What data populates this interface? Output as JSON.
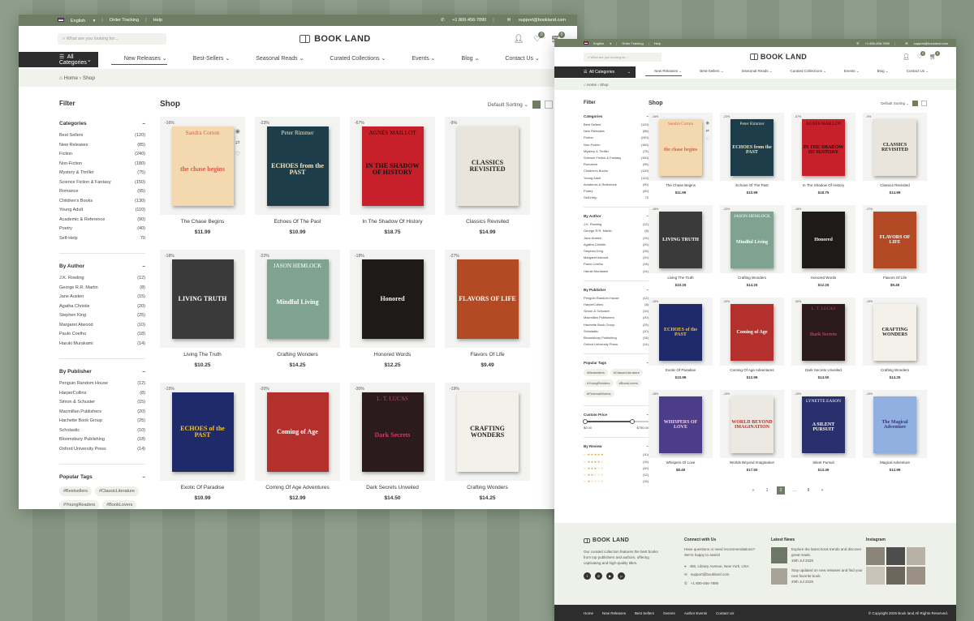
{
  "topbar": {
    "language": "English",
    "order_tracking": "Order Tracking",
    "help": "Help",
    "phone": "+1 800-456-7890",
    "email": "support@bookland.com"
  },
  "header": {
    "search_placeholder": "What are you looking for...",
    "logo": "BOOK LAND",
    "wishlist_count": "0",
    "cart_count": "0"
  },
  "nav": {
    "all_categories": "All Categories",
    "items": [
      "New Releases",
      "Best-Sellers",
      "Seasonal Reads",
      "Curated Collections",
      "Events",
      "Blog",
      "Contact Us"
    ]
  },
  "breadcrumb": {
    "home": "Home",
    "current": "Shop"
  },
  "filter": {
    "title": "Filter",
    "categories": {
      "heading": "Categories",
      "items": [
        {
          "label": "Best Sellers",
          "count": "(120)"
        },
        {
          "label": "New Releases",
          "count": "(85)"
        },
        {
          "label": "Fiction",
          "count": "(240)"
        },
        {
          "label": "Non-Fiction",
          "count": "(180)"
        },
        {
          "label": "Mystery & Thriller",
          "count": "(75)"
        },
        {
          "label": "Science Fiction & Fantasy",
          "count": "(150)"
        },
        {
          "label": "Romance",
          "count": "(95)"
        },
        {
          "label": "Children's Books",
          "count": "(130)"
        },
        {
          "label": "Young Adult",
          "count": "(110)"
        },
        {
          "label": "Academic & Reference",
          "count": "(90)"
        },
        {
          "label": "Poetry",
          "count": "(40)"
        },
        {
          "label": "Self-Help",
          "count": "70"
        }
      ]
    },
    "authors": {
      "heading": "By Author",
      "items": [
        {
          "label": "J.K. Rowling",
          "count": "(12)"
        },
        {
          "label": "George R.R. Martin",
          "count": "(8)"
        },
        {
          "label": "Jane Austen",
          "count": "(15)"
        },
        {
          "label": "Agatha Christie",
          "count": "(20)"
        },
        {
          "label": "Stephen King",
          "count": "(25)"
        },
        {
          "label": "Margaret Atwood",
          "count": "(10)"
        },
        {
          "label": "Paulo Coelho",
          "count": "(18)"
        },
        {
          "label": "Haruki Murakami",
          "count": "(14)"
        }
      ]
    },
    "publishers": {
      "heading": "By Publisher",
      "items": [
        {
          "label": "Penguin Random House",
          "count": "(12)"
        },
        {
          "label": "HarperCollins",
          "count": "(8)"
        },
        {
          "label": "Simon & Schuster",
          "count": "(15)"
        },
        {
          "label": "Macmillan Publishers",
          "count": "(20)"
        },
        {
          "label": "Hachette Book Group",
          "count": "(25)"
        },
        {
          "label": "Scholastic",
          "count": "(10)"
        },
        {
          "label": "Bloomsbury Publishing",
          "count": "(18)"
        },
        {
          "label": "Oxford University Press",
          "count": "(14)"
        }
      ]
    },
    "tags": {
      "heading": "Popular Tags",
      "items": [
        "#Bestsellers",
        "#ClassicLiterature",
        "#YoungReaders",
        "#BookLovers",
        "#FictionalWorlds"
      ]
    },
    "price": {
      "heading": "Custom Price",
      "min": "$0.00",
      "max": "$750.00",
      "fill": 0.75
    },
    "review": {
      "heading": "By Review",
      "items": [
        {
          "stars": 5,
          "count": "(10)"
        },
        {
          "stars": 4,
          "count": "(15)"
        },
        {
          "stars": 3,
          "count": "(40)"
        },
        {
          "stars": 2,
          "count": "(12)"
        },
        {
          "stars": 1,
          "count": "(15)"
        }
      ]
    }
  },
  "shop": {
    "title": "Shop",
    "sort": "Default Sorting",
    "pagination": [
      "«",
      "1",
      "2",
      "...",
      "8",
      "»"
    ],
    "current_page": "2"
  },
  "books": [
    {
      "title": "The Chase Begins",
      "price": "$11.99",
      "discount": "-16%",
      "cover_title": "the chase begins",
      "cover_author": "Sandra Corton",
      "bg": "#f4d9b0",
      "fg": "#e05a48"
    },
    {
      "title": "Echoes Of The Past",
      "price": "$10.99",
      "discount": "-23%",
      "cover_title": "ECHOES from the PAST",
      "cover_author": "Peter Rimmer",
      "bg": "#1d3d4a",
      "fg": "#f2e6c8"
    },
    {
      "title": "In The Shadow Of History",
      "price": "$18.75",
      "discount": "-67%",
      "cover_title": "IN THE SHADOW OF HISTORY",
      "cover_author": "AGNÈS MAILLOT",
      "bg": "#c8202a",
      "fg": "#111"
    },
    {
      "title": "Classics Revisited",
      "price": "$14.99",
      "discount": "-9%",
      "cover_title": "CLASSICS REVISITED",
      "cover_author": "",
      "bg": "#e9e5dc",
      "fg": "#222"
    },
    {
      "title": "Living The Truth",
      "price": "$10.25",
      "discount": "-18%",
      "cover_title": "LIVING TRUTH",
      "cover_author": "",
      "bg": "#3a3a3a",
      "fg": "#fff"
    },
    {
      "title": "Crafting Wonders",
      "price": "$14.25",
      "discount": "-22%",
      "cover_title": "Mindful Living",
      "cover_author": "JASON HEMLOCK",
      "bg": "#7fa291",
      "fg": "#fff"
    },
    {
      "title": "Honored Words",
      "price": "$12.25",
      "discount": "-18%",
      "cover_title": "Honored",
      "cover_author": "",
      "bg": "#1e1a17",
      "fg": "#f2f2f2"
    },
    {
      "title": "Flavors Of Life",
      "price": "$9.49",
      "discount": "-27%",
      "cover_title": "FLAVORS OF LIFE",
      "cover_author": "",
      "bg": "#b34a23",
      "fg": "#fff"
    },
    {
      "title": "Exotic Of Paradise",
      "price": "$10.99",
      "discount": "-15%",
      "cover_title": "ECHOES of the PAST",
      "cover_author": "",
      "bg": "#1f2a6b",
      "fg": "#f2c53a"
    },
    {
      "title": "Coming Of Age Adventures",
      "price": "$12.99",
      "discount": "-20%",
      "cover_title": "Coming of Age",
      "cover_author": "",
      "bg": "#b3302c",
      "fg": "#fff"
    },
    {
      "title": "Dark Secrets Unveiled",
      "price": "$14.50",
      "discount": "-30%",
      "cover_title": "Dark Secrets",
      "cover_author": "L. T. LUCAS",
      "bg": "#2b1a1e",
      "fg": "#d43a66"
    },
    {
      "title": "Crafting Wonders",
      "price": "$14.25",
      "discount": "-19%",
      "cover_title": "CRAFTING WONDERS",
      "cover_author": "",
      "bg": "#f4f0ea",
      "fg": "#222"
    },
    {
      "title": "Whispers Of Love",
      "price": "$8.49",
      "discount": "-18%",
      "cover_title": "WHISPERS OF LOVE",
      "cover_author": "",
      "bg": "#4b3d8a",
      "fg": "#f5d0e8"
    },
    {
      "title": "Worlds Beyond Imagination",
      "price": "$17.50",
      "discount": "-19%",
      "cover_title": "WORLD BEYOND IMAGINATION",
      "cover_author": "",
      "bg": "#ece8e2",
      "fg": "#b3302c"
    },
    {
      "title": "Silent Pursuit",
      "price": "$13.49",
      "discount": "-19%",
      "cover_title": "A SILENT PURSUIT",
      "cover_author": "LYNETTE EASON",
      "bg": "#2a2f6e",
      "fg": "#fff"
    },
    {
      "title": "Magical Adventure",
      "price": "$12.99",
      "discount": "-19%",
      "cover_title": "The Magical Adventure",
      "cover_author": "",
      "bg": "#8fb0e0",
      "fg": "#3a2f7a"
    }
  ],
  "footer": {
    "about": "Our curated collection features the best books from top publishers and authors, offering captivating and high-quality titles.",
    "connect": {
      "heading": "Connect with Us",
      "text": "Have questions or need recommendations? We're happy to assist!",
      "address": "456, Library Avenue, New York, USA",
      "email": "support@bookland.com",
      "phone": "+1 800-456-7890"
    },
    "news": {
      "heading": "Latest News",
      "items": [
        {
          "title": "Explore the latest book trends and discover great reads.",
          "date": "15th Jul 2025"
        },
        {
          "title": "Stay updated on new releases and find your next favorite book.",
          "date": "20th Jul 2025"
        }
      ]
    },
    "instagram": {
      "heading": "Instagram"
    },
    "links": [
      "Home",
      "New Releases",
      "Best Sellers",
      "Genres",
      "Author Events",
      "Contact Us"
    ],
    "copyright": "© Copyright 2025 Book land All Rights Reserved."
  }
}
